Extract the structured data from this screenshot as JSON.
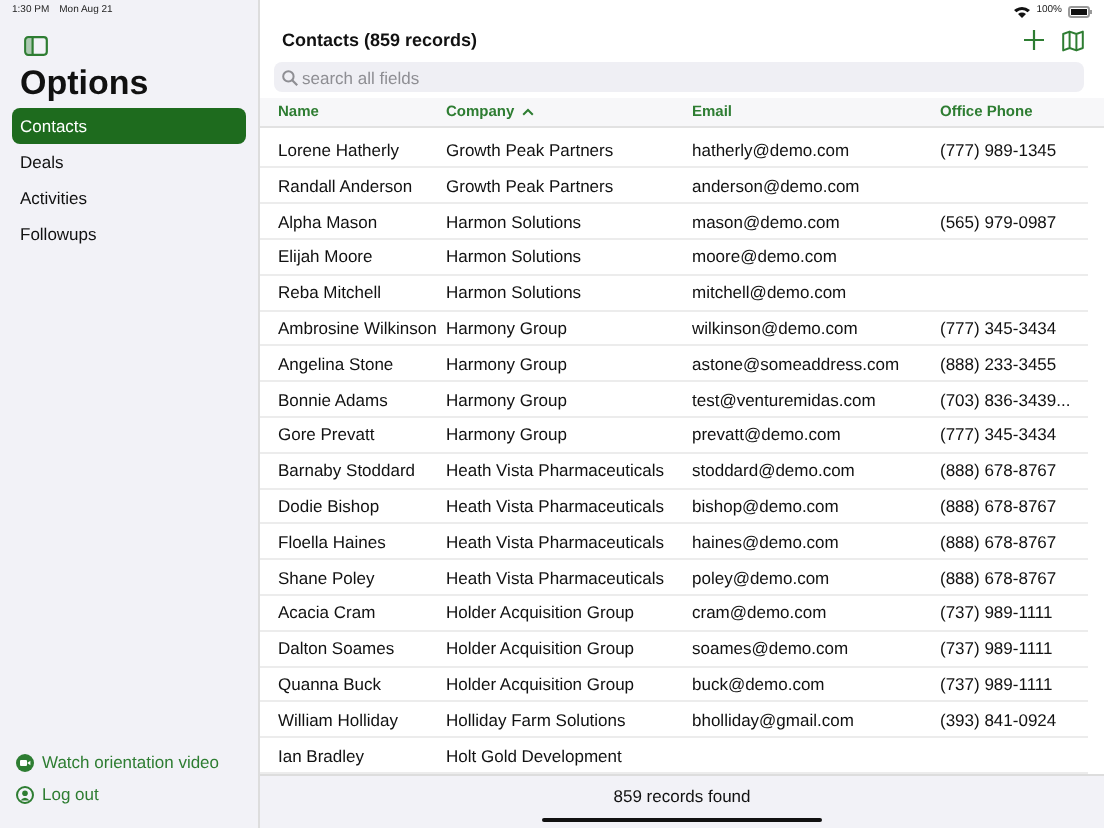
{
  "status_bar": {
    "time": "1:30 PM",
    "date": "Mon Aug 21",
    "battery": "100%"
  },
  "sidebar": {
    "title": "Options",
    "items": [
      {
        "label": "Contacts",
        "selected": true
      },
      {
        "label": "Deals",
        "selected": false
      },
      {
        "label": "Activities",
        "selected": false
      },
      {
        "label": "Followups",
        "selected": false
      }
    ],
    "footer_links": [
      {
        "kind": "video",
        "label": "Watch orientation video"
      },
      {
        "kind": "logout",
        "label": "Log out"
      }
    ]
  },
  "header": {
    "title": "Contacts (859 records)"
  },
  "search": {
    "placeholder": "search all fields"
  },
  "table": {
    "columns": [
      {
        "label": "Name",
        "sorted": false
      },
      {
        "label": "Company",
        "sorted": true
      },
      {
        "label": "Email",
        "sorted": false
      },
      {
        "label": "Office Phone",
        "sorted": false
      }
    ],
    "rows": [
      [
        "Lorene Hatherly",
        "Growth Peak Partners",
        "hatherly@demo.com",
        "(777) 989-1345"
      ],
      [
        "Randall Anderson",
        "Growth Peak Partners",
        "anderson@demo.com",
        ""
      ],
      [
        "Alpha Mason",
        "Harmon Solutions",
        "mason@demo.com",
        "(565) 979-0987"
      ],
      [
        "Elijah Moore",
        "Harmon Solutions",
        "moore@demo.com",
        ""
      ],
      [
        "Reba Mitchell",
        "Harmon Solutions",
        "mitchell@demo.com",
        ""
      ],
      [
        "Ambrosine Wilkinson",
        "Harmony Group",
        "wilkinson@demo.com",
        "(777) 345-3434"
      ],
      [
        "Angelina Stone",
        "Harmony Group",
        "astone@someaddress.com",
        "(888) 233-3455"
      ],
      [
        "Bonnie Adams",
        "Harmony Group",
        "test@venturemidas.com",
        "(703) 836-3439..."
      ],
      [
        "Gore Prevatt",
        "Harmony Group",
        "prevatt@demo.com",
        "(777) 345-3434"
      ],
      [
        "Barnaby Stoddard",
        "Heath Vista Pharmaceuticals",
        "stoddard@demo.com",
        "(888) 678-8767"
      ],
      [
        "Dodie Bishop",
        "Heath Vista Pharmaceuticals",
        "bishop@demo.com",
        "(888) 678-8767"
      ],
      [
        "Floella Haines",
        "Heath Vista Pharmaceuticals",
        "haines@demo.com",
        "(888) 678-8767"
      ],
      [
        "Shane Poley",
        "Heath Vista Pharmaceuticals",
        "poley@demo.com",
        "(888) 678-8767"
      ],
      [
        "Acacia Cram",
        "Holder Acquisition Group",
        "cram@demo.com",
        "(737) 989-1111"
      ],
      [
        "Dalton Soames",
        "Holder Acquisition Group",
        "soames@demo.com",
        "(737) 989-1111"
      ],
      [
        "Quanna Buck",
        "Holder Acquisition Group",
        "buck@demo.com",
        "(737) 989-1111"
      ],
      [
        "William Holliday",
        "Holliday Farm Solutions",
        "bholliday@gmail.com",
        "(393) 841-0924"
      ],
      [
        "Ian Bradley",
        "Holt Gold Development",
        "",
        ""
      ]
    ]
  },
  "footer": {
    "text": "859 records found"
  }
}
